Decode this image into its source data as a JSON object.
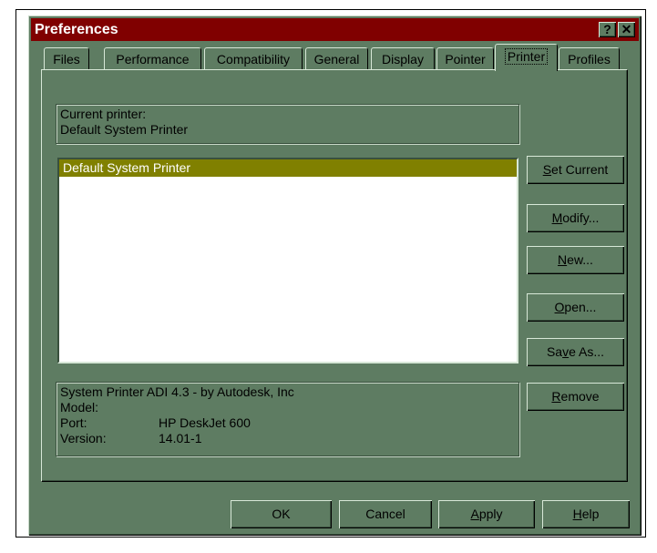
{
  "window": {
    "title": "Preferences",
    "help_button": "?",
    "close_button": "✕"
  },
  "tabs": [
    {
      "label": "Files"
    },
    {
      "label": "Performance"
    },
    {
      "label": "Compatibility"
    },
    {
      "label": "General"
    },
    {
      "label": "Display"
    },
    {
      "label": "Pointer"
    },
    {
      "label": "Printer"
    },
    {
      "label": "Profiles"
    }
  ],
  "active_tab": "Printer",
  "current_printer": {
    "label": "Current printer:",
    "value": "Default System Printer"
  },
  "printer_list": {
    "items": [
      "Default System Printer"
    ],
    "selected": "Default System Printer"
  },
  "side_buttons": {
    "set_current": {
      "pre": "",
      "key": "S",
      "post": "et Current"
    },
    "modify": {
      "pre": "",
      "key": "M",
      "post": "odify..."
    },
    "new": {
      "pre": "",
      "key": "N",
      "post": "ew..."
    },
    "open": {
      "pre": "",
      "key": "O",
      "post": "pen..."
    },
    "save_as": {
      "pre": "Sa",
      "key": "v",
      "post": "e As..."
    },
    "remove": {
      "pre": "",
      "key": "R",
      "post": "emove"
    }
  },
  "printer_info": {
    "driver": "System Printer ADI 4.3 - by Autodesk, Inc",
    "model_label": "Model:",
    "model_value": "",
    "port_label": "Port:",
    "port_value": "HP DeskJet 600",
    "version_label": "Version:",
    "version_value": "14.01-1"
  },
  "bottom_buttons": {
    "ok": {
      "pre": "OK",
      "key": "",
      "post": ""
    },
    "cancel": {
      "pre": "Cancel",
      "key": "",
      "post": ""
    },
    "apply": {
      "pre": "",
      "key": "A",
      "post": "pply"
    },
    "help": {
      "pre": "",
      "key": "H",
      "post": "elp"
    }
  },
  "colors": {
    "face": "#5e7c62",
    "titlebar": "#800000",
    "selection": "#808000"
  }
}
